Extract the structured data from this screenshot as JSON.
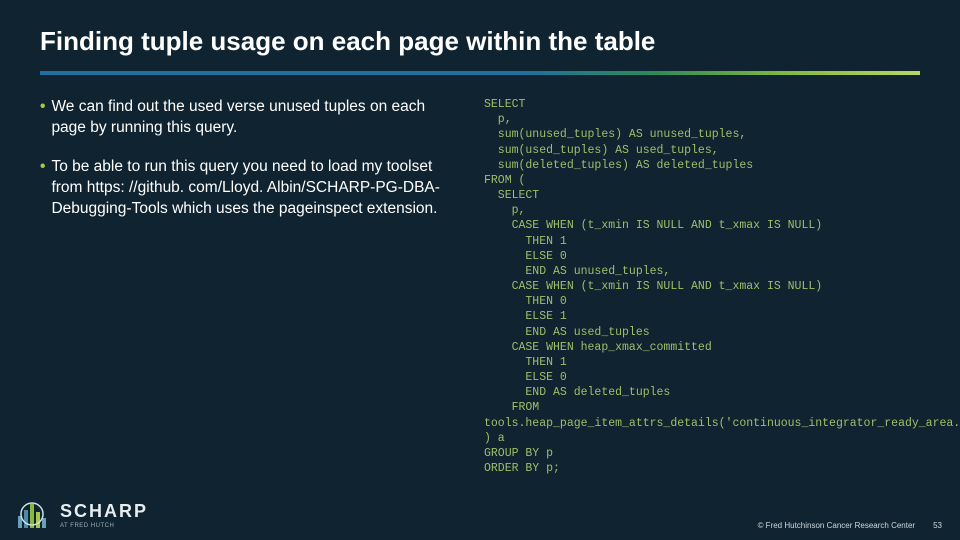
{
  "title": "Finding tuple usage on each page within the table",
  "bullets": [
    "We can find out the used verse unused tuples on each page by running this query.",
    "To be able to run this query you need to load my toolset from https: //github. com/Lloyd. Albin/SCHARP-PG-DBA-Debugging-Tools which uses the pageinspect extension."
  ],
  "code": "SELECT\n  p,\n  sum(unused_tuples) AS unused_tuples,\n  sum(used_tuples) AS used_tuples,\n  sum(deleted_tuples) AS deleted_tuples\nFROM (\n  SELECT\n    p,\n    CASE WHEN (t_xmin IS NULL AND t_xmax IS NULL)\n      THEN 1\n      ELSE 0\n      END AS unused_tuples,\n    CASE WHEN (t_xmin IS NULL AND t_xmax IS NULL)\n      THEN 0\n      ELSE 1\n      END AS used_tuples\n    CASE WHEN heap_xmax_committed\n      THEN 1\n      ELSE 0\n      END AS deleted_tuples\n    FROM\ntools.heap_page_item_attrs_details('continuous_integrator_ready_area.dataset')\n) a\nGROUP BY p\nORDER BY p;",
  "footer_copyright": "© Fred Hutchinson Cancer Research Center",
  "footer_page": "53",
  "logo_text": "SCHARP",
  "logo_sub": "AT FRED HUTCH"
}
